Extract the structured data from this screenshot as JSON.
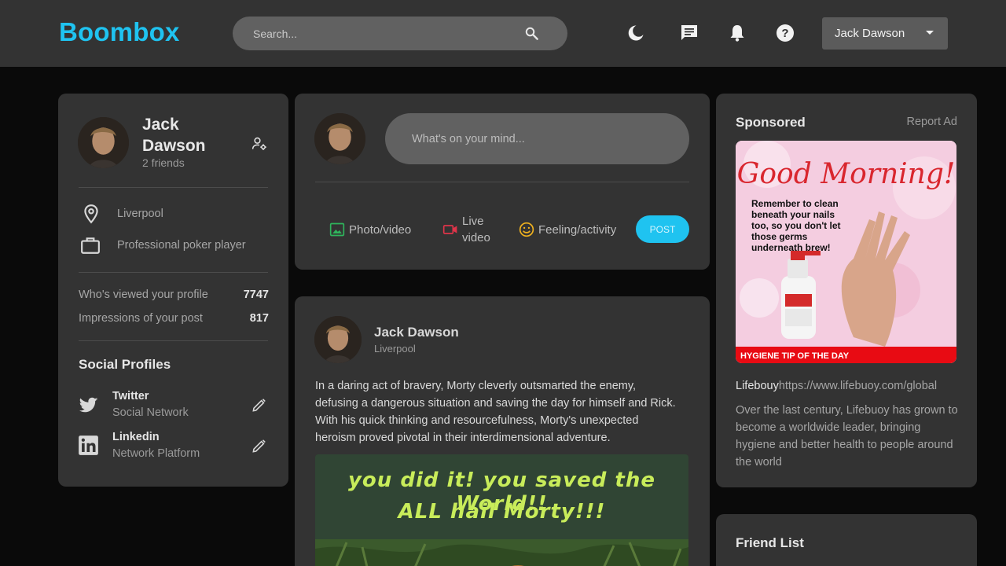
{
  "app": {
    "logo": "Boombox"
  },
  "nav": {
    "search_placeholder": "Search...",
    "icons": [
      "moon-icon",
      "chat-icon",
      "bell-icon",
      "help-icon"
    ],
    "user_name": "Jack Dawson",
    "accent": "#1fc3f0"
  },
  "profile": {
    "name": "Jack Dawson",
    "friends": "2 friends",
    "location": "Liverpool",
    "occupation": "Professional poker player",
    "stats": [
      {
        "label": "Who's viewed your profile",
        "value": "7747"
      },
      {
        "label": "Impressions of your post",
        "value": "817"
      }
    ],
    "social_title": "Social Profiles",
    "socials": [
      {
        "name": "Twitter",
        "sub": "Social Network",
        "icon": "twitter-icon"
      },
      {
        "name": "Linkedin",
        "sub": "Network Platform",
        "icon": "linkedin-icon"
      }
    ]
  },
  "composer": {
    "placeholder": "What's on your mind...",
    "actions": [
      {
        "label": "Photo/video",
        "icon": "image-icon",
        "color": "#2fb55c"
      },
      {
        "label": "Live video",
        "line1": "Live",
        "line2": "video",
        "icon": "video-icon",
        "color": "#e0344a"
      },
      {
        "label": "Feeling/activity",
        "icon": "smiley-icon",
        "color": "#f0b21f"
      }
    ],
    "post_button": "POST"
  },
  "post": {
    "author": "Jack Dawson",
    "location": "Liverpool",
    "text": "In a daring act of bravery, Morty cleverly outsmarted the enemy, defusing a dangerous situation and saving the day for himself and Rick. With his quick thinking and resourcefulness, Morty's unexpected heroism proved pivotal in their interdimensional adventure.",
    "image_caption_line1": "you did it! you saved the World!!",
    "image_caption_line2": "ALL hail Morty!!!"
  },
  "sponsored": {
    "title": "Sponsored",
    "report": "Report Ad",
    "ad_headline": "Good Morning!",
    "ad_body": "Remember to clean beneath your nails too, so you don't let those germs underneath brew!",
    "ad_band": "HYGIENE TIP OF THE DAY",
    "brand": "Lifebouy",
    "url": "https://www.lifebuoy.com/global",
    "description": "Over the last century, Lifebuoy has grown to become a worldwide leader, bringing hygiene and better health to people around the world"
  },
  "friends": {
    "title": "Friend List"
  }
}
